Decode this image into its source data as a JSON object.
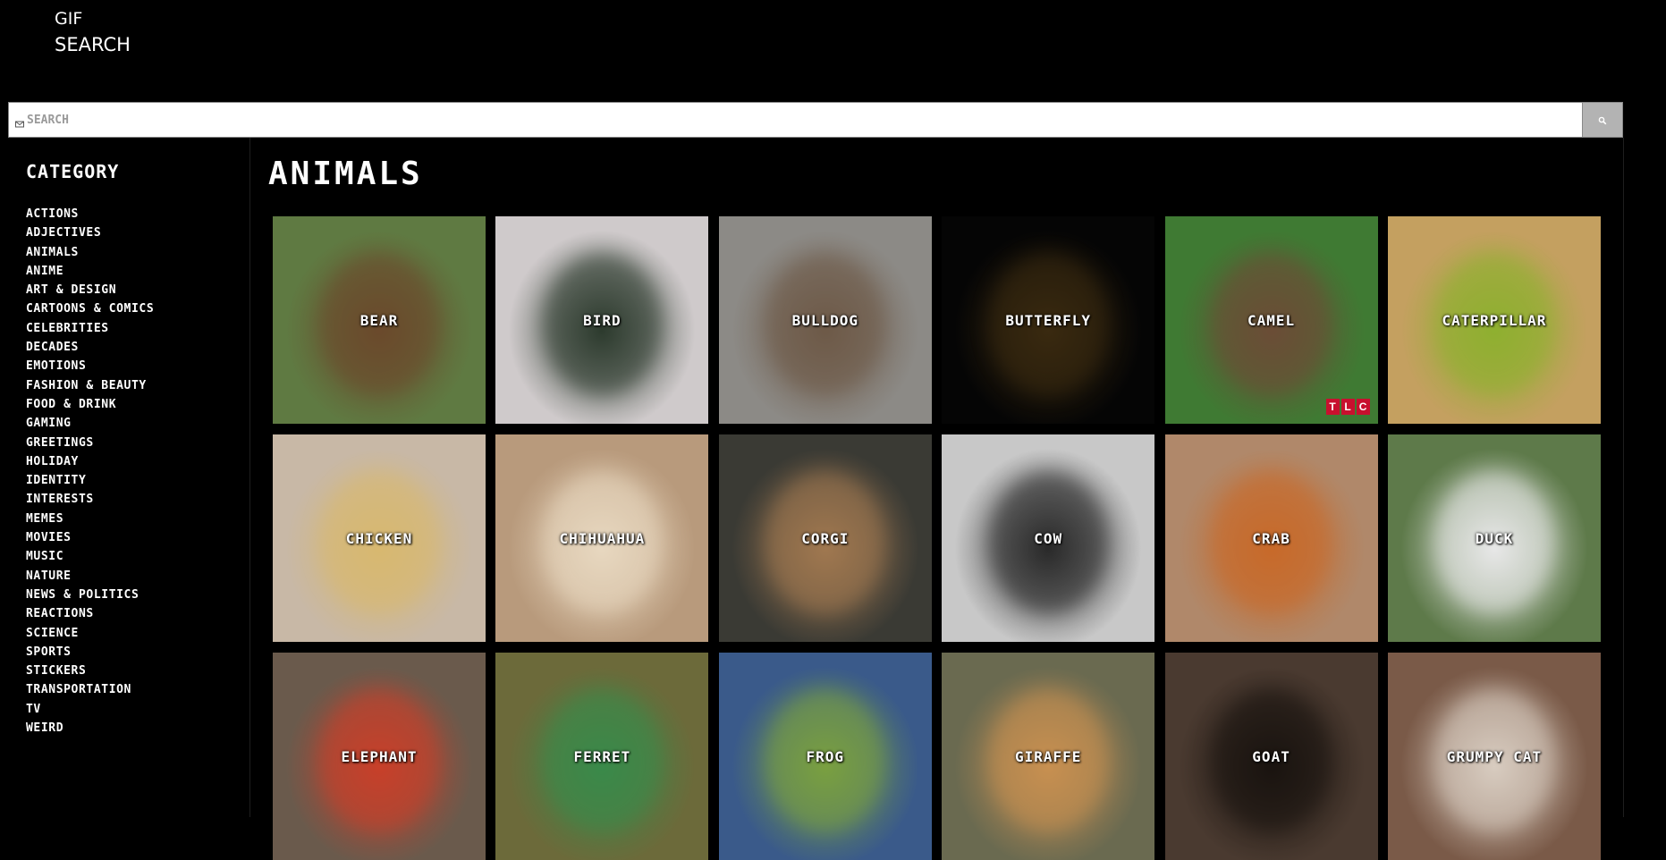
{
  "logo": {
    "line1": "GIF",
    "line2": "SEARCH"
  },
  "search": {
    "placeholder": "SEARCH",
    "value": ""
  },
  "sidebar": {
    "heading": "CATEGORY",
    "items": [
      "ACTIONS",
      "ADJECTIVES",
      "ANIMALS",
      "ANIME",
      "ART & DESIGN",
      "CARTOONS & COMICS",
      "CELEBRITIES",
      "DECADES",
      "EMOTIONS",
      "FASHION & BEAUTY",
      "FOOD & DRINK",
      "GAMING",
      "GREETINGS",
      "HOLIDAY",
      "IDENTITY",
      "INTERESTS",
      "MEMES",
      "MOVIES",
      "MUSIC",
      "NATURE",
      "NEWS & POLITICS",
      "REACTIONS",
      "SCIENCE",
      "SPORTS",
      "STICKERS",
      "TRANSPORTATION",
      "TV",
      "WEIRD"
    ]
  },
  "main": {
    "title": "ANIMALS",
    "tiles": [
      {
        "label": "BEAR",
        "bg": "#5f7a42",
        "fg": "#6b4a2c"
      },
      {
        "label": "BIRD",
        "bg": "#cfcacb",
        "fg": "#2d3b2e"
      },
      {
        "label": "BULLDOG",
        "bg": "#8c8a86",
        "fg": "#6e5a48"
      },
      {
        "label": "BUTTERFLY",
        "bg": "#050505",
        "fg": "#3a2a10"
      },
      {
        "label": "CAMEL",
        "bg": "#3f7a33",
        "fg": "#6b4d36",
        "badge": [
          "T",
          "L",
          "C"
        ]
      },
      {
        "label": "CATERPILLAR",
        "bg": "#c4a060",
        "fg": "#8fb030"
      },
      {
        "label": "CHICKEN",
        "bg": "#c8b8a6",
        "fg": "#d8b870"
      },
      {
        "label": "CHIHUAHUA",
        "bg": "#b89a7c",
        "fg": "#e8d8c0"
      },
      {
        "label": "CORGI",
        "bg": "#3a3a34",
        "fg": "#a07850"
      },
      {
        "label": "COW",
        "bg": "#c8c8c8",
        "fg": "#2a2a2a"
      },
      {
        "label": "CRAB",
        "bg": "#b0886a",
        "fg": "#c86a2a"
      },
      {
        "label": "DUCK",
        "bg": "#5e7a4a",
        "fg": "#e8e8e8"
      },
      {
        "label": "ELEPHANT",
        "bg": "#6a5a4c",
        "fg": "#c8402a"
      },
      {
        "label": "FERRET",
        "bg": "#6c6a3a",
        "fg": "#3a8a4a"
      },
      {
        "label": "FROG",
        "bg": "#3a5a8a",
        "fg": "#7aa040"
      },
      {
        "label": "GIRAFFE",
        "bg": "#6a6a50",
        "fg": "#c89050"
      },
      {
        "label": "GOAT",
        "bg": "#4a3a30",
        "fg": "#1a1410"
      },
      {
        "label": "GRUMPY  CAT",
        "bg": "#7a5a48",
        "fg": "#d8ccc0"
      }
    ]
  },
  "colors": {
    "background": "#000000",
    "search_button": "#b3b3b3",
    "badge": "#c8102e"
  },
  "icons": {
    "search_field": "mail-icon",
    "search_button": "search-icon"
  }
}
